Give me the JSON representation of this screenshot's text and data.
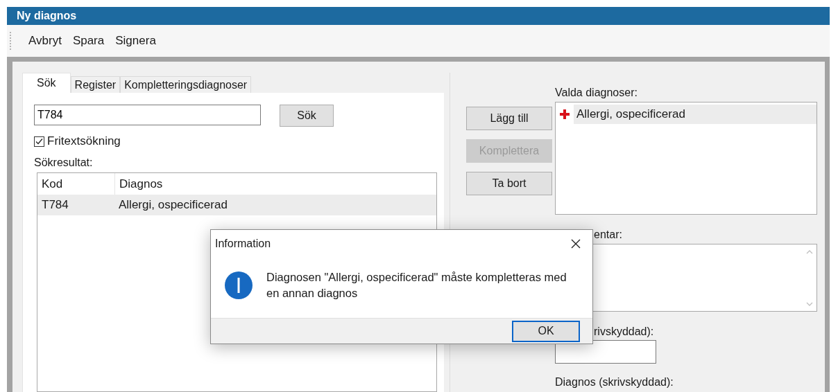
{
  "window": {
    "title": "Ny diagnos"
  },
  "toolbar": [
    "Avbryt",
    "Spara",
    "Signera"
  ],
  "tabs": [
    {
      "label": "Sök",
      "selected": true
    },
    {
      "label": "Register",
      "selected": false
    },
    {
      "label": "Kompletteringsdiagnoser",
      "selected": false
    }
  ],
  "search": {
    "value": "T784",
    "button": "Sök"
  },
  "free_text_search": {
    "label": "Fritextsökning",
    "checked": true
  },
  "results": {
    "label": "Sökresultat:",
    "columns": [
      "Kod",
      "Diagnos"
    ],
    "rows": [
      {
        "cells": [
          "T784",
          "Allergi, ospecificerad"
        ],
        "selected": true
      }
    ]
  },
  "actions": [
    {
      "label": "Lägg till",
      "disabled": false
    },
    {
      "label": "Komplettera",
      "disabled": true
    },
    {
      "label": "Ta bort",
      "disabled": false
    }
  ],
  "selected_diagnoses": {
    "label": "Valda diagnoser:",
    "items": [
      {
        "label": "Allergi, ospecificerad",
        "selected": true
      }
    ]
  },
  "comment": {
    "label": "entar:"
  },
  "readonly_field": {
    "label": "rivskyddad):"
  },
  "diagnosis_readonly": {
    "label": "Diagnos (skrivskyddad):"
  },
  "dialog": {
    "title": "Information",
    "message": "Diagnosen \"Allergi, ospecificerad\" måste kompletteras med en annan diagnos",
    "button": "OK"
  }
}
